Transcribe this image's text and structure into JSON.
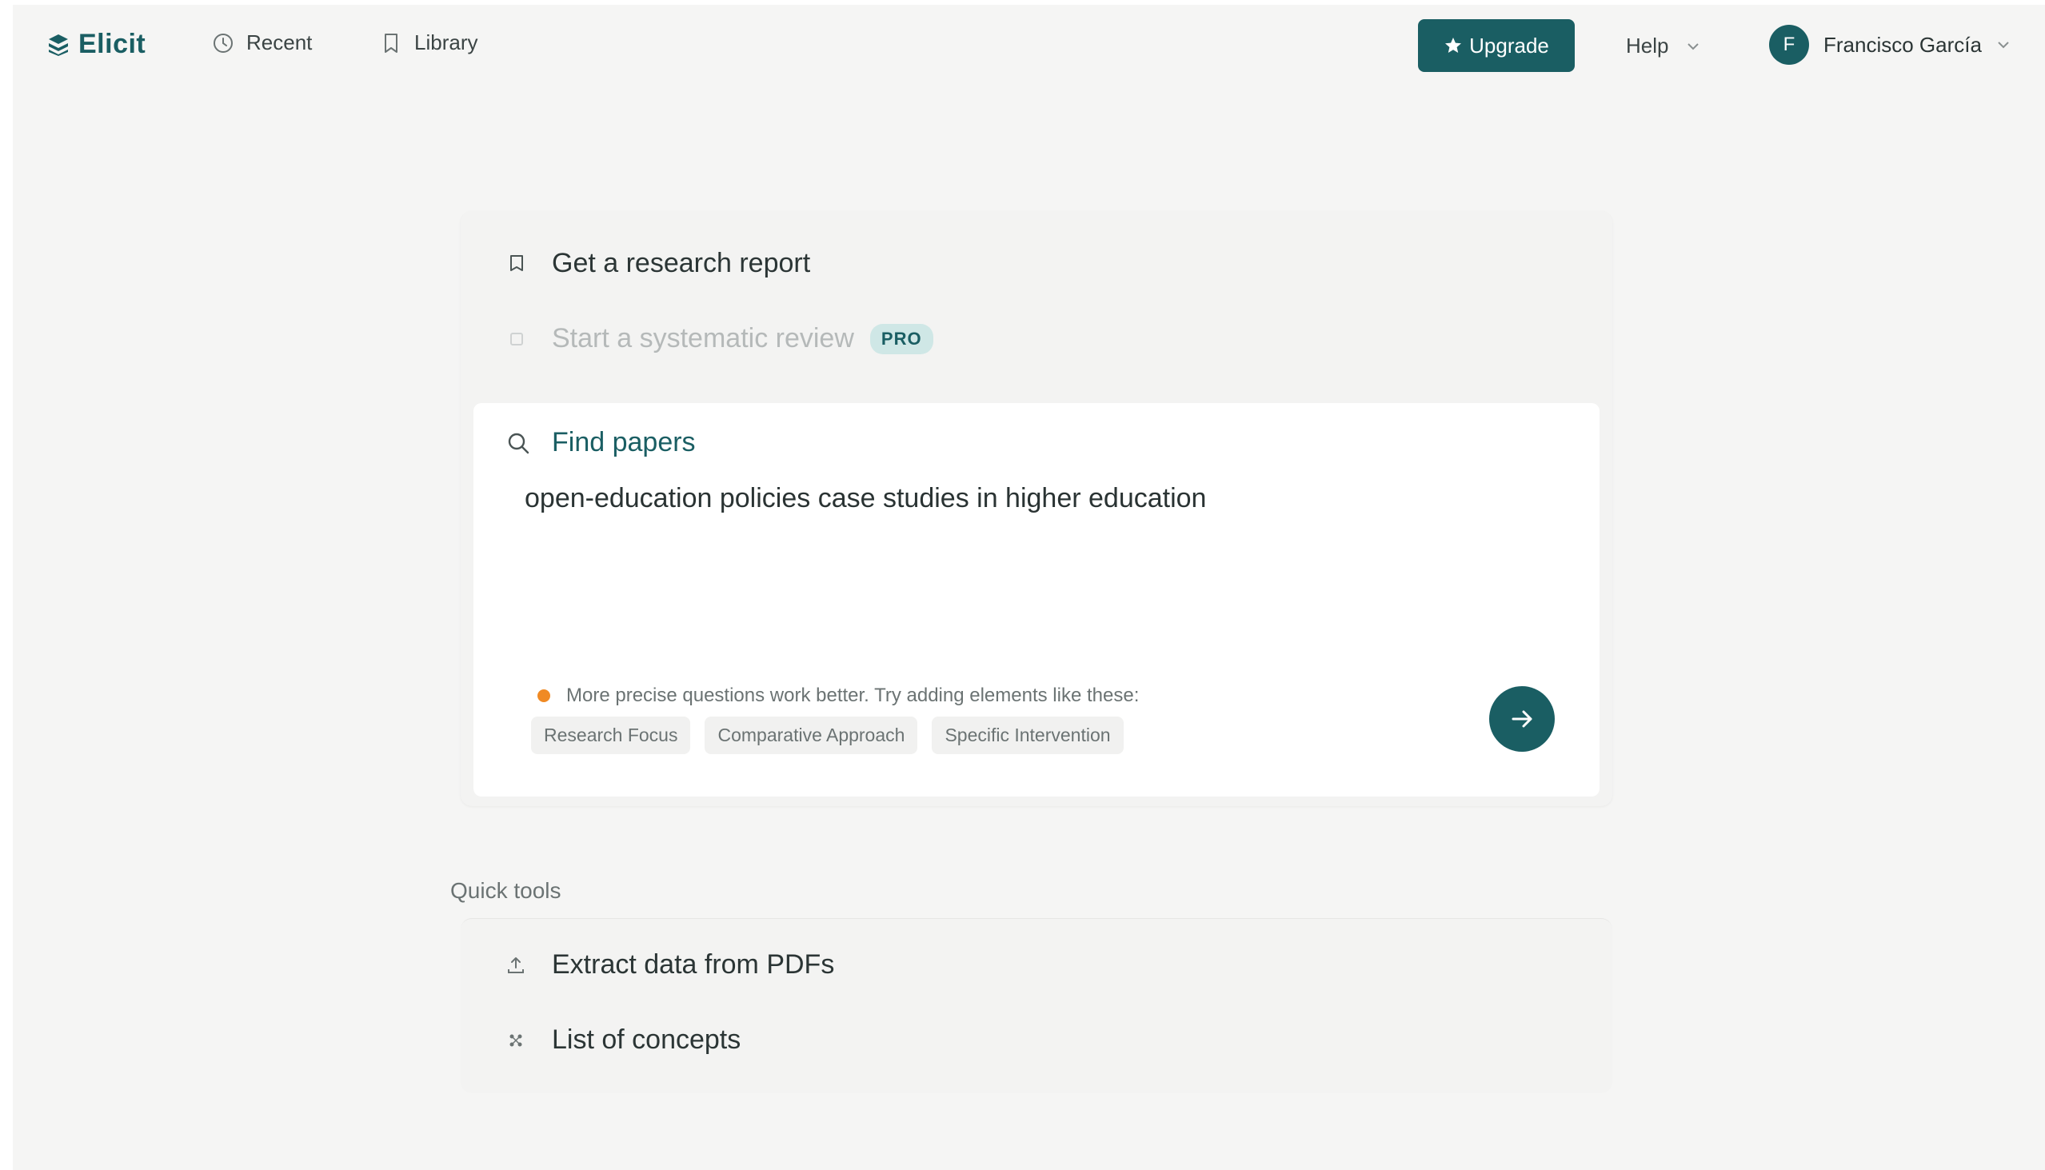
{
  "header": {
    "brand": "Elicit",
    "nav": [
      {
        "label": "Recent",
        "icon": "clock-icon"
      },
      {
        "label": "Library",
        "icon": "bookmark-icon"
      }
    ],
    "upgrade_label": "Upgrade",
    "help_label": "Help",
    "user": {
      "initial": "F",
      "name": "Francisco García"
    }
  },
  "modes": {
    "report_label": "Get a research report",
    "systematic_label": "Start a systematic review",
    "pro_badge": "PRO",
    "find_label": "Find papers"
  },
  "search": {
    "query": "open-education policies case studies in higher education",
    "hint": "More precise questions work better. Try adding elements like these:",
    "chips": [
      "Research Focus",
      "Comparative Approach",
      "Specific Intervention"
    ]
  },
  "quick_tools": {
    "title": "Quick tools",
    "items": [
      {
        "label": "Extract data from PDFs",
        "icon": "upload-icon"
      },
      {
        "label": "List of concepts",
        "icon": "concepts-icon"
      }
    ]
  },
  "colors": {
    "brand": "#1a5e63",
    "accent_dot": "#f08a24",
    "background": "#f5f5f4"
  }
}
